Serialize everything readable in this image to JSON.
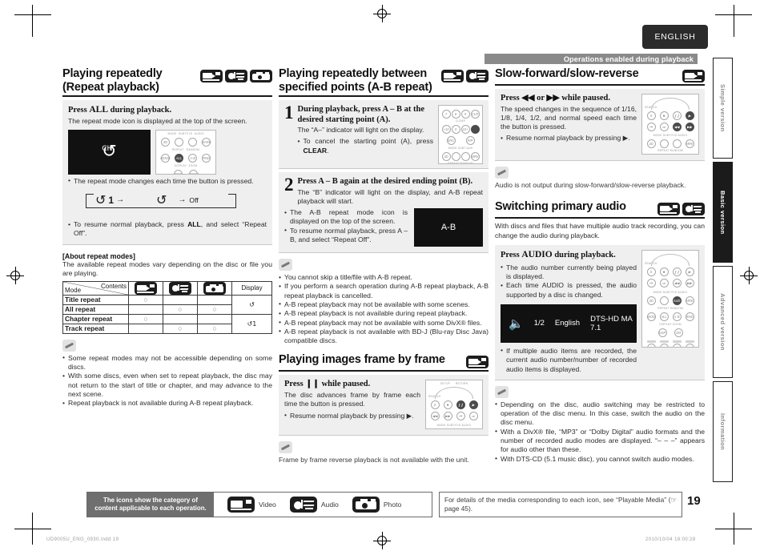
{
  "header": {
    "language_tab": "ENGLISH",
    "ops_bar": "Operations enabled during playback"
  },
  "side_tabs": [
    {
      "label": "Simple version",
      "active": false
    },
    {
      "label": "Basic version",
      "active": true
    },
    {
      "label": "Advanced version",
      "active": false
    },
    {
      "label": "Information",
      "active": false
    }
  ],
  "col1": {
    "title_line1": "Playing repeatedly",
    "title_line2": "(Repeat playback)",
    "step_head_pre": "Press ",
    "step_head_key": "ALL",
    "step_head_post": " during playback.",
    "step_sub": "The repeat mode icon is displayed at the top of the screen.",
    "tv_glyph": "CH",
    "bullet1": "The repeat mode changes each time the button is pressed.",
    "flow_item1": "1",
    "flow_item2": "",
    "flow_item3": "Off",
    "bullet2_pre": "To resume normal playback, press ",
    "bullet2_key": "ALL",
    "bullet2_post": ", and select “Repeat Off”.",
    "about_head": "[About repeat modes]",
    "about_text": "The available repeat modes vary depending on the disc or file you are playing.",
    "table": {
      "corner_contents": "Contents",
      "corner_mode": "Mode",
      "col_display": "Display",
      "rows": [
        {
          "mode": "Title repeat",
          "video": "○",
          "audio": "",
          "photo": "",
          "display": "↺"
        },
        {
          "mode": "All repeat",
          "video": "",
          "audio": "○",
          "photo": "○",
          "display": ""
        },
        {
          "mode": "Chapter repeat",
          "video": "○",
          "audio": "",
          "photo": "",
          "display": "↺1"
        },
        {
          "mode": "Track repeat",
          "video": "",
          "audio": "○",
          "photo": "○",
          "display": ""
        }
      ]
    },
    "notes": [
      "Some repeat modes may not be accessible depending on some discs.",
      "With some discs, even when set to repeat playback, the disc may not return to the start of title or chapter, and may advance to the next scene.",
      "Repeat playback is not available during A-B repeat playback."
    ]
  },
  "col2": {
    "title_line1": "Playing repeatedly between",
    "title_line2": "specified points (A-B repeat)",
    "step1_num": "1",
    "step1_head": "During playback, press A – B at the desired starting point (A).",
    "step1_sub": "The “A–” indicator will light on the display.",
    "step1_bullet_pre": "To cancel the starting point (A), press ",
    "step1_bullet_key": "CLEAR",
    "step1_bullet_post": ".",
    "step2_num": "2",
    "step2_head": "Press A – B again at the desired ending point (B).",
    "step2_sub": "The “B” indicator will light on the display, and A-B repeat playback will start.",
    "step2_bullets": [
      "The A-B repeat mode icon is displayed on the top of the screen.",
      "To resume normal playback, press A – B, and select “Repeat Off”."
    ],
    "tv_text": "A-B",
    "notes": [
      "You cannot skip a title/file with A-B repeat.",
      "If you perform a search operation during A-B repeat playback, A-B repeat playback is cancelled.",
      "A-B repeat playback may not be available with some scenes.",
      "A-B repeat playback is not available during repeat playback.",
      "A-B repeat playback may not be available with some DivX® files.",
      "A-B repeat playback is not available with BD-J (Blu-ray Disc Java) compatible discs."
    ],
    "frame_title": "Playing images frame by frame",
    "frame_step_pre": "Press ",
    "frame_step_key": "❙❙",
    "frame_step_post": " while paused.",
    "frame_sub": "The disc advances frame by frame each time the button is pressed.",
    "frame_bullet": "Resume normal playback by pressing ▶.",
    "frame_note": "Frame by frame reverse playback is not available with the unit."
  },
  "col3": {
    "slow_title": "Slow-forward/slow-reverse",
    "slow_step_pre": "Press ",
    "slow_step_key1": "◀◀",
    "slow_step_mid": " or ",
    "slow_step_key2": "▶▶",
    "slow_step_post": " while paused.",
    "slow_sub": "The speed changes in the sequence of 1/16, 1/8, 1/4, 1/2, and normal speed each time the button is pressed.",
    "slow_bullet": "Resume normal playback by pressing ▶.",
    "slow_note": "Audio is not output during slow-forward/slow-reverse playback.",
    "audio_title": "Switching primary audio",
    "audio_lead": "With discs and files that have multiple audio track recording, you can change the audio during playback.",
    "audio_step_pre": "Press ",
    "audio_step_key": "AUDIO",
    "audio_step_post": " during playback.",
    "audio_bullets": [
      "The audio number currently being played is displayed.",
      "Each time AUDIO is pressed, the audio supported by a disc is changed."
    ],
    "osd_number": "1/2",
    "osd_language": "English",
    "osd_format": "DTS-HD MA 7.1",
    "audio_bullet_after": "If multiple audio items are recorded, the current audio number/number of recorded audio items is displayed.",
    "notes": [
      "Depending on the disc, audio switching may be restricted to operation of the disc menu. In this case, switch the audio on the disc menu.",
      "With a DivX® file, “MP3” or “Dolby Digital” audio formats and the number of recorded audio modes are displayed. “– – –” appears for audio other than these.",
      "With DTS-CD (5.1 music disc), you cannot switch audio modes."
    ]
  },
  "footer": {
    "legend_caption_l1": "The icons show the category of",
    "legend_caption_l2": "content applicable to each operation.",
    "legend_items": [
      {
        "icon": "video-icon",
        "label": "Video"
      },
      {
        "icon": "audio-icon",
        "label": "Audio"
      },
      {
        "icon": "photo-icon",
        "label": "Photo"
      }
    ],
    "note": "For details of the media corresponding to each icon, see “Playable Media” (☞ page 45).",
    "page_number": "19",
    "file_stamp": "UD9005U_ENG_0930.indd   19",
    "date_stamp": "2010/10/04   18:00:28"
  }
}
